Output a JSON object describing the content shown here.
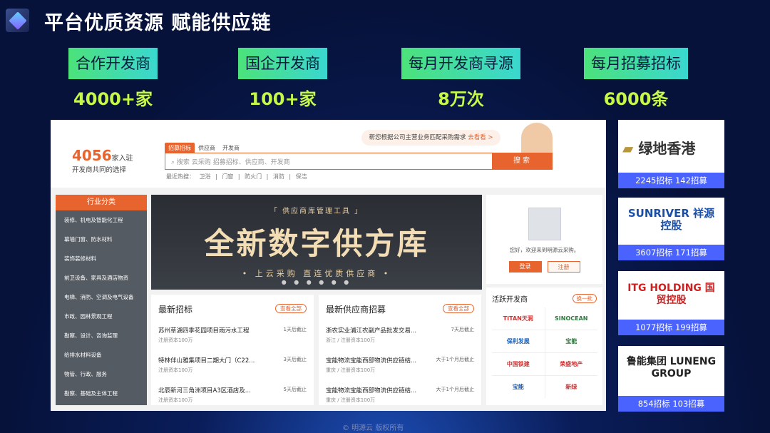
{
  "title": "平台优质资源 赋能供应链",
  "stats": [
    {
      "label": "合作开发商",
      "value": "4000+家"
    },
    {
      "label": "国企开发商",
      "value": "100+家"
    },
    {
      "label": "每月开发商寻源",
      "value": "8万次"
    },
    {
      "label": "每月招募招标",
      "value": "6000条"
    }
  ],
  "shot": {
    "count": "4056",
    "count_unit": "家入驻",
    "count_sub": "开发商共同的选择",
    "tabs": [
      "招募招标",
      "供应商",
      "开发商"
    ],
    "search_placeholder": "搜索 云采购 招募招标、供应商、开发商",
    "search_button": "搜索",
    "hot": "最近热搜： 卫浴 | 门窗 | 防火门 | 消防 | 保洁",
    "bubble": "帮您根据公司主营业务匹配采购需求",
    "bubble_link": "去看看 >",
    "category_title": "行业分类",
    "categories": [
      "装修、机电及智能化工程",
      "幕墙门窗、防水材料",
      "装饰装修材料",
      "前卫设备、家具及酒店物资",
      "电梯、消防、空调及电气设备",
      "市政、园林景观工程",
      "勘察、设计、咨询监理",
      "给排水材料设备",
      "物管、行政、服务",
      "勘察、基础及主体工程"
    ],
    "banner_top": "「 供应商库管理工具 」",
    "banner_main": "全新数字供方库",
    "banner_sub": "• 上云采购  直连优质供应商 •",
    "banner_dots": "● ● ● ● ● ●",
    "tender_title": "最新招标",
    "tender_more": "查看全部",
    "tenders": [
      {
        "t": "苏州草湖四季花园项目雨污水工程",
        "s": "注册资本100万",
        "r": "1天后截止"
      },
      {
        "t": "特林伴山雅集项目二期大门（C22...",
        "s": "注册资本100万",
        "r": "3天后截止"
      },
      {
        "t": "北辰新河三角洲项目A3区酒店及...",
        "s": "注册资本100万",
        "r": "5天后截止"
      }
    ],
    "recruit_title": "最新供应商招募",
    "recruit_more": "查看全部",
    "recruits": [
      {
        "t": "浙农实业浦江农副产品批发交易...",
        "s": "浙江 / 注册资本100万",
        "r": "7天后截止"
      },
      {
        "t": "宝能物流宝能西部物流供应链结...",
        "s": "重庆 / 注册资本100万",
        "r": "大于1个月后截止"
      },
      {
        "t": "宝能物流宝能西部物流供应链结...",
        "s": "重庆 / 注册资本100万",
        "r": "大于1个月后截止"
      }
    ],
    "welcome": "您好，欢迎来到明源云采购。",
    "login": "登录",
    "register": "注册",
    "active_title": "活跃开发商",
    "active_more": "换一批",
    "dev_logos": [
      "TITAN天润",
      "SINOCEAN",
      "保利发展",
      "宝能",
      "中国铁建",
      "荣盛地产",
      "宝能",
      "新绿"
    ]
  },
  "brands": [
    {
      "name": "绿地香港",
      "count": "2245招标  142招募"
    },
    {
      "name": "SUNRIVER 祥源控股",
      "count": "3607招标  171招募"
    },
    {
      "name": "ITG HOLDING 国贸控股",
      "count": "1077招标  199招募"
    },
    {
      "name": "鲁能集团 LUNENG GROUP",
      "count": "854招标  103招募"
    }
  ],
  "footer": "© 明源云  版权所有"
}
